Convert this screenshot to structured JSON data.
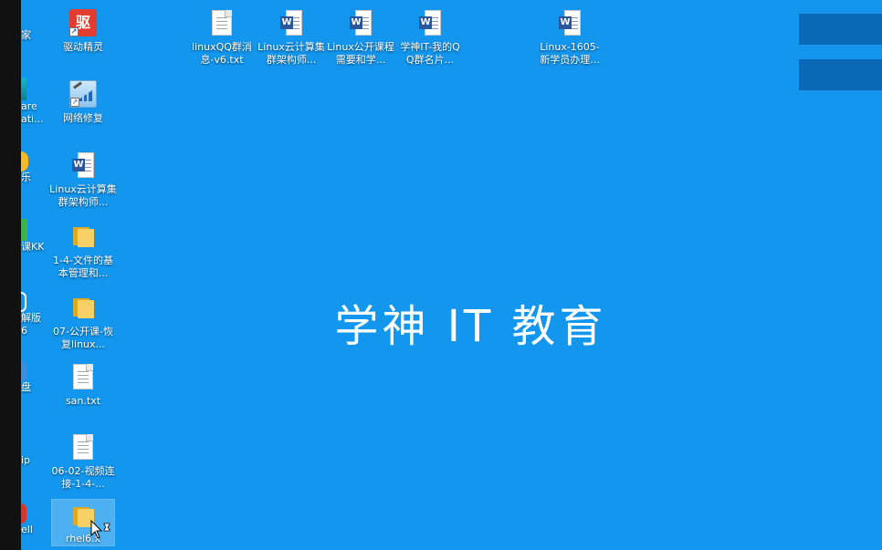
{
  "wallpaper_text": "学神 IT 教育",
  "colors": {
    "desktop": "#1296ee",
    "accent_bar": "#0b68b8"
  },
  "partial_icons": [
    {
      "label": "家",
      "icon": "app-icon"
    },
    {
      "label": "are\nati...",
      "icon": "app-icon"
    },
    {
      "label": "乐",
      "icon": "music-icon"
    },
    {
      "label": "课KK",
      "icon": "app-icon"
    },
    {
      "label": "解版\n6",
      "icon": "app-icon"
    },
    {
      "label": "盘",
      "icon": "disk-icon"
    },
    {
      "label": "ip",
      "icon": "app-icon"
    },
    {
      "label": "ell",
      "icon": "app-icon"
    }
  ],
  "column_icons": [
    {
      "label": "驱动精灵",
      "icon": "qudong-icon"
    },
    {
      "label": "网络修复",
      "icon": "network-repair-icon"
    },
    {
      "label": "Linux云计算集群架构师...",
      "icon": "word-doc-icon"
    },
    {
      "label": "1-4-文件的基本管理和...",
      "icon": "folder-icon"
    },
    {
      "label": "07-公开课-恢复linux...",
      "icon": "folder-icon"
    },
    {
      "label": "san.txt",
      "icon": "text-file-icon"
    },
    {
      "label": "06-02-视频连接-1-4-...",
      "icon": "text-file-icon"
    },
    {
      "label": "rhel6.x",
      "icon": "folder-icon"
    }
  ],
  "top_icons": [
    {
      "label": "linuxQQ群消息-v6.txt",
      "icon": "text-file-icon"
    },
    {
      "label": "Linux云计算集群架构师...",
      "icon": "word-doc-icon"
    },
    {
      "label": "Linux公开课程需要和学...",
      "icon": "word-doc-icon"
    },
    {
      "label": "学神IT-我的QQ群名片...",
      "icon": "word-doc-icon"
    },
    {
      "label": "Linux-1605-新学员办理...",
      "icon": "word-doc-icon"
    }
  ]
}
